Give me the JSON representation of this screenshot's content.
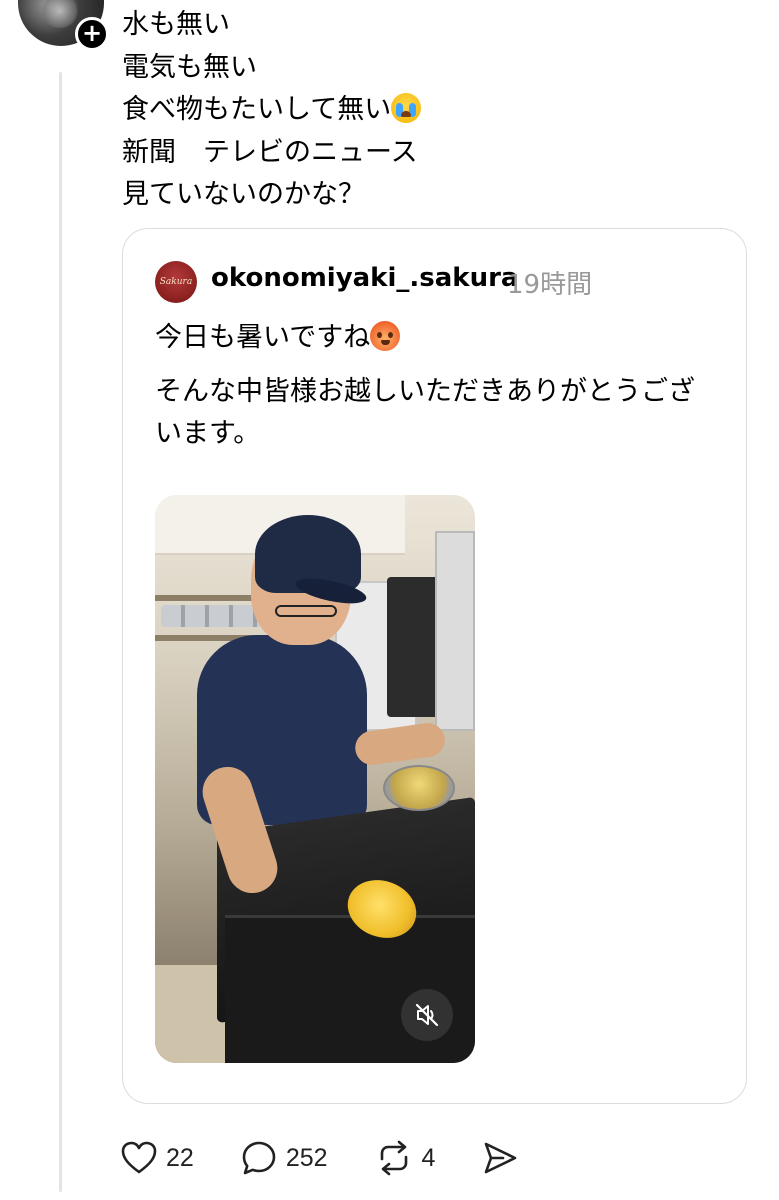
{
  "post": {
    "lines": [
      "水も無い",
      "電気も無い",
      "食べ物もたいして無い",
      "新聞　テレビのニュース",
      "見ていないのかな？"
    ],
    "emoji_line3": "loudly-crying-face"
  },
  "quote": {
    "avatar_text": "Sakura",
    "username": "okonomiyaki_.sakura",
    "time": "19時間",
    "paragraph1": "今日も暑いですね",
    "emoji_para1": "hot-face",
    "paragraph2": "そんな中皆様お越しいただきありがとうございます。"
  },
  "actions": {
    "like_count": "22",
    "reply_count": "252",
    "repost_count": "4"
  },
  "colors": {
    "text": "#000000",
    "muted": "#999999",
    "border": "#dcdcdc",
    "thread_line": "#e4e4e4"
  }
}
